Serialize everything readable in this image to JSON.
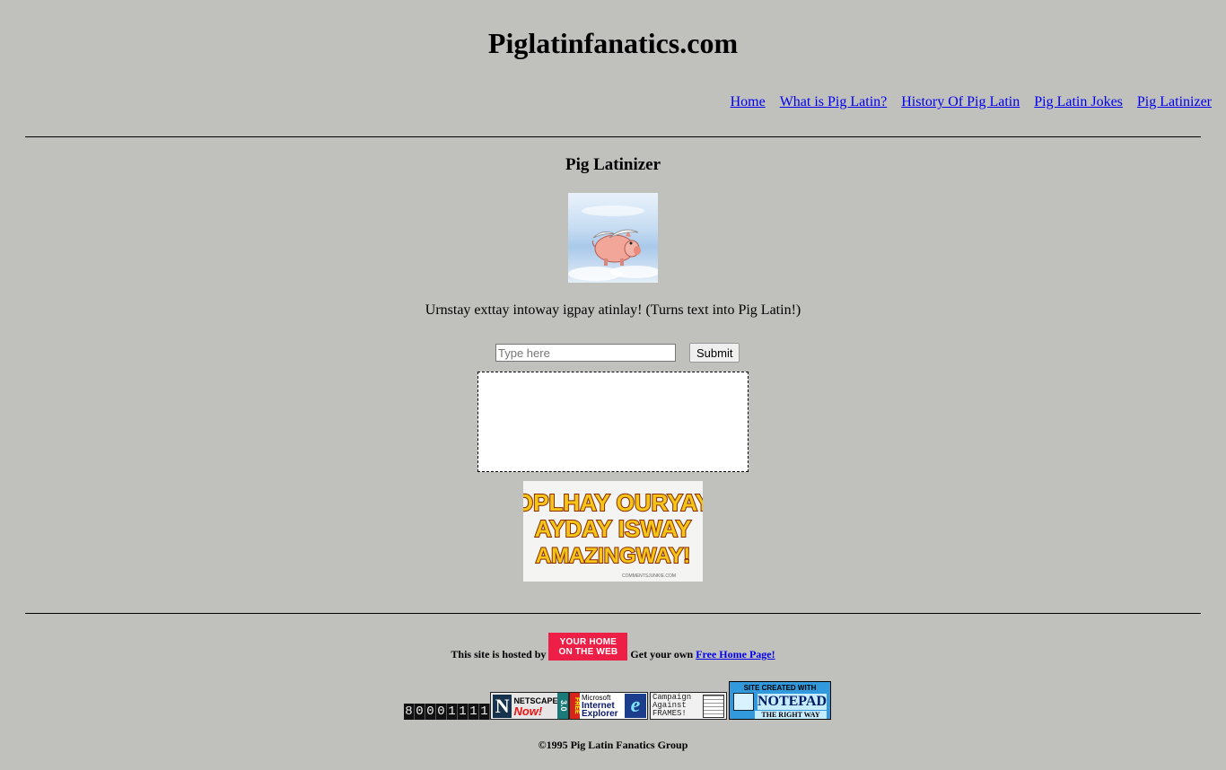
{
  "site": {
    "title": "Piglatinfanatics.com"
  },
  "nav": {
    "items": [
      {
        "label": "Home"
      },
      {
        "label": "What is Pig Latin?"
      },
      {
        "label": "History Of Pig Latin"
      },
      {
        "label": "Pig Latin Jokes"
      },
      {
        "label": "Pig Latinizer"
      }
    ]
  },
  "main": {
    "title": "Pig Latinizer",
    "image_icon": "flying-pig-icon",
    "description": "Urnstay exttay intoway igpay atinlay! (Turns text into Pig Latin!)",
    "input": {
      "placeholder": "Type here",
      "value": ""
    },
    "submit_label": "Submit",
    "output": "",
    "banner": {
      "lines": [
        "OPLHAY OURYAY",
        "AYDAY ISWAY",
        "AMAZINGWAY!"
      ],
      "credit": "COMMENTSJUNKIE.COM",
      "colors": {
        "fill": "#f5c518",
        "outline": "#8a2a00"
      }
    }
  },
  "footer": {
    "hosted_prefix": "This site is hosted by",
    "host_badge": {
      "line1": "YOUR HOME",
      "line2": "ON THE WEB",
      "color": "#ee1f47"
    },
    "hosted_mid": "Get your own",
    "free_link": "Free Home Page!",
    "counter_digits": [
      "8",
      "0",
      "0",
      "0",
      "1",
      "1",
      "1",
      "1"
    ],
    "badges": {
      "netscape": {
        "top": "NETSCAPE",
        "now": "Now!",
        "version": "3.0"
      },
      "ie": {
        "free": "FREE",
        "line1": "Microsoft",
        "line2": "Internet",
        "line3": "Explorer",
        "logo": "e"
      },
      "frames": {
        "line1": "Campaign",
        "line2": "Against",
        "line3": "FRAMES!"
      },
      "notepad": {
        "top": "SITE CREATED WITH",
        "name": "NOTEPAD",
        "bottom": "THE RIGHT WAY"
      }
    },
    "copyright": "©1995 Pig Latin Fanatics Group"
  },
  "colors": {
    "background": "#c0c0bd",
    "link": "#0000ee"
  }
}
